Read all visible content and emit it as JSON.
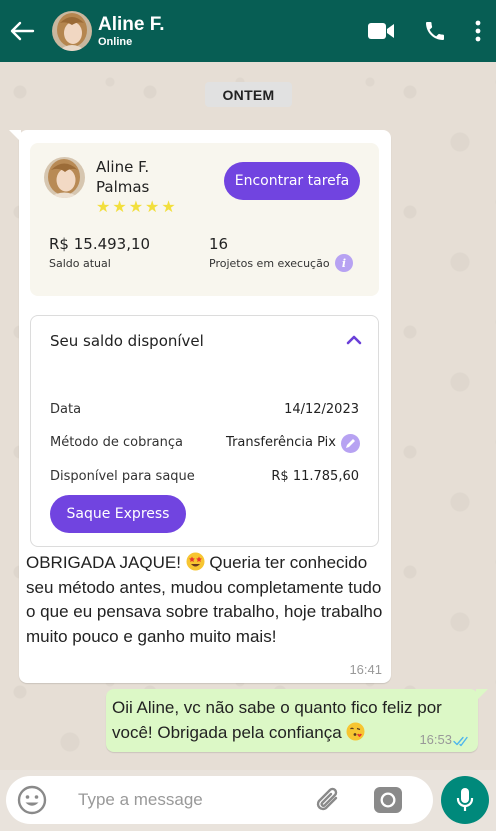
{
  "header": {
    "name": "Aline F.",
    "status": "Online",
    "icons": [
      "back-arrow-icon",
      "video-call-icon",
      "phone-icon",
      "more-vertical-icon"
    ]
  },
  "chat": {
    "date_divider": "ONTEM",
    "incoming": {
      "card": {
        "profile_name": "Aline F. Palmas",
        "rating_stars": 5,
        "find_task_button": "Encontrar tarefa",
        "balance_value": "R$ 15.493,10",
        "balance_label": "Saldo atual",
        "projects_value": "16",
        "projects_label": "Projetos em execução",
        "info_glyph": "i"
      },
      "balance_panel": {
        "title": "Seu saldo disponível",
        "rows": [
          {
            "label": "Data",
            "value": "14/12/2023"
          },
          {
            "label": "Método de cobrança",
            "value": "Transferência Pix"
          },
          {
            "label": "Disponível para saque",
            "value": "R$ 11.785,60"
          }
        ],
        "express_button": "Saque Express"
      },
      "text_before_emoji": "OBRIGADA JAQUE!",
      "text_after_emoji": "Queria ter conhecido seu método antes, mudou completamente tudo o que eu pensava sobre trabalho, hoje trabalho muito pouco e ganho muito mais!",
      "emoji": "star-struck-emoji",
      "time": "16:41"
    },
    "outgoing": {
      "text": "Oii Aline, vc não sabe o quanto fico feliz por você! Obrigada pela confiança",
      "emoji": "face-blowing-kiss-emoji",
      "time": "16:53",
      "status": "read"
    }
  },
  "composer": {
    "placeholder": "Type a message",
    "icons": [
      "emoji-icon",
      "paperclip-icon",
      "camera-icon",
      "microphone-icon"
    ]
  },
  "colors": {
    "header": "#075e54",
    "accent_purple": "#7144e0",
    "outgoing_bubble": "#dcf8c6",
    "mic_button": "#00897b"
  }
}
